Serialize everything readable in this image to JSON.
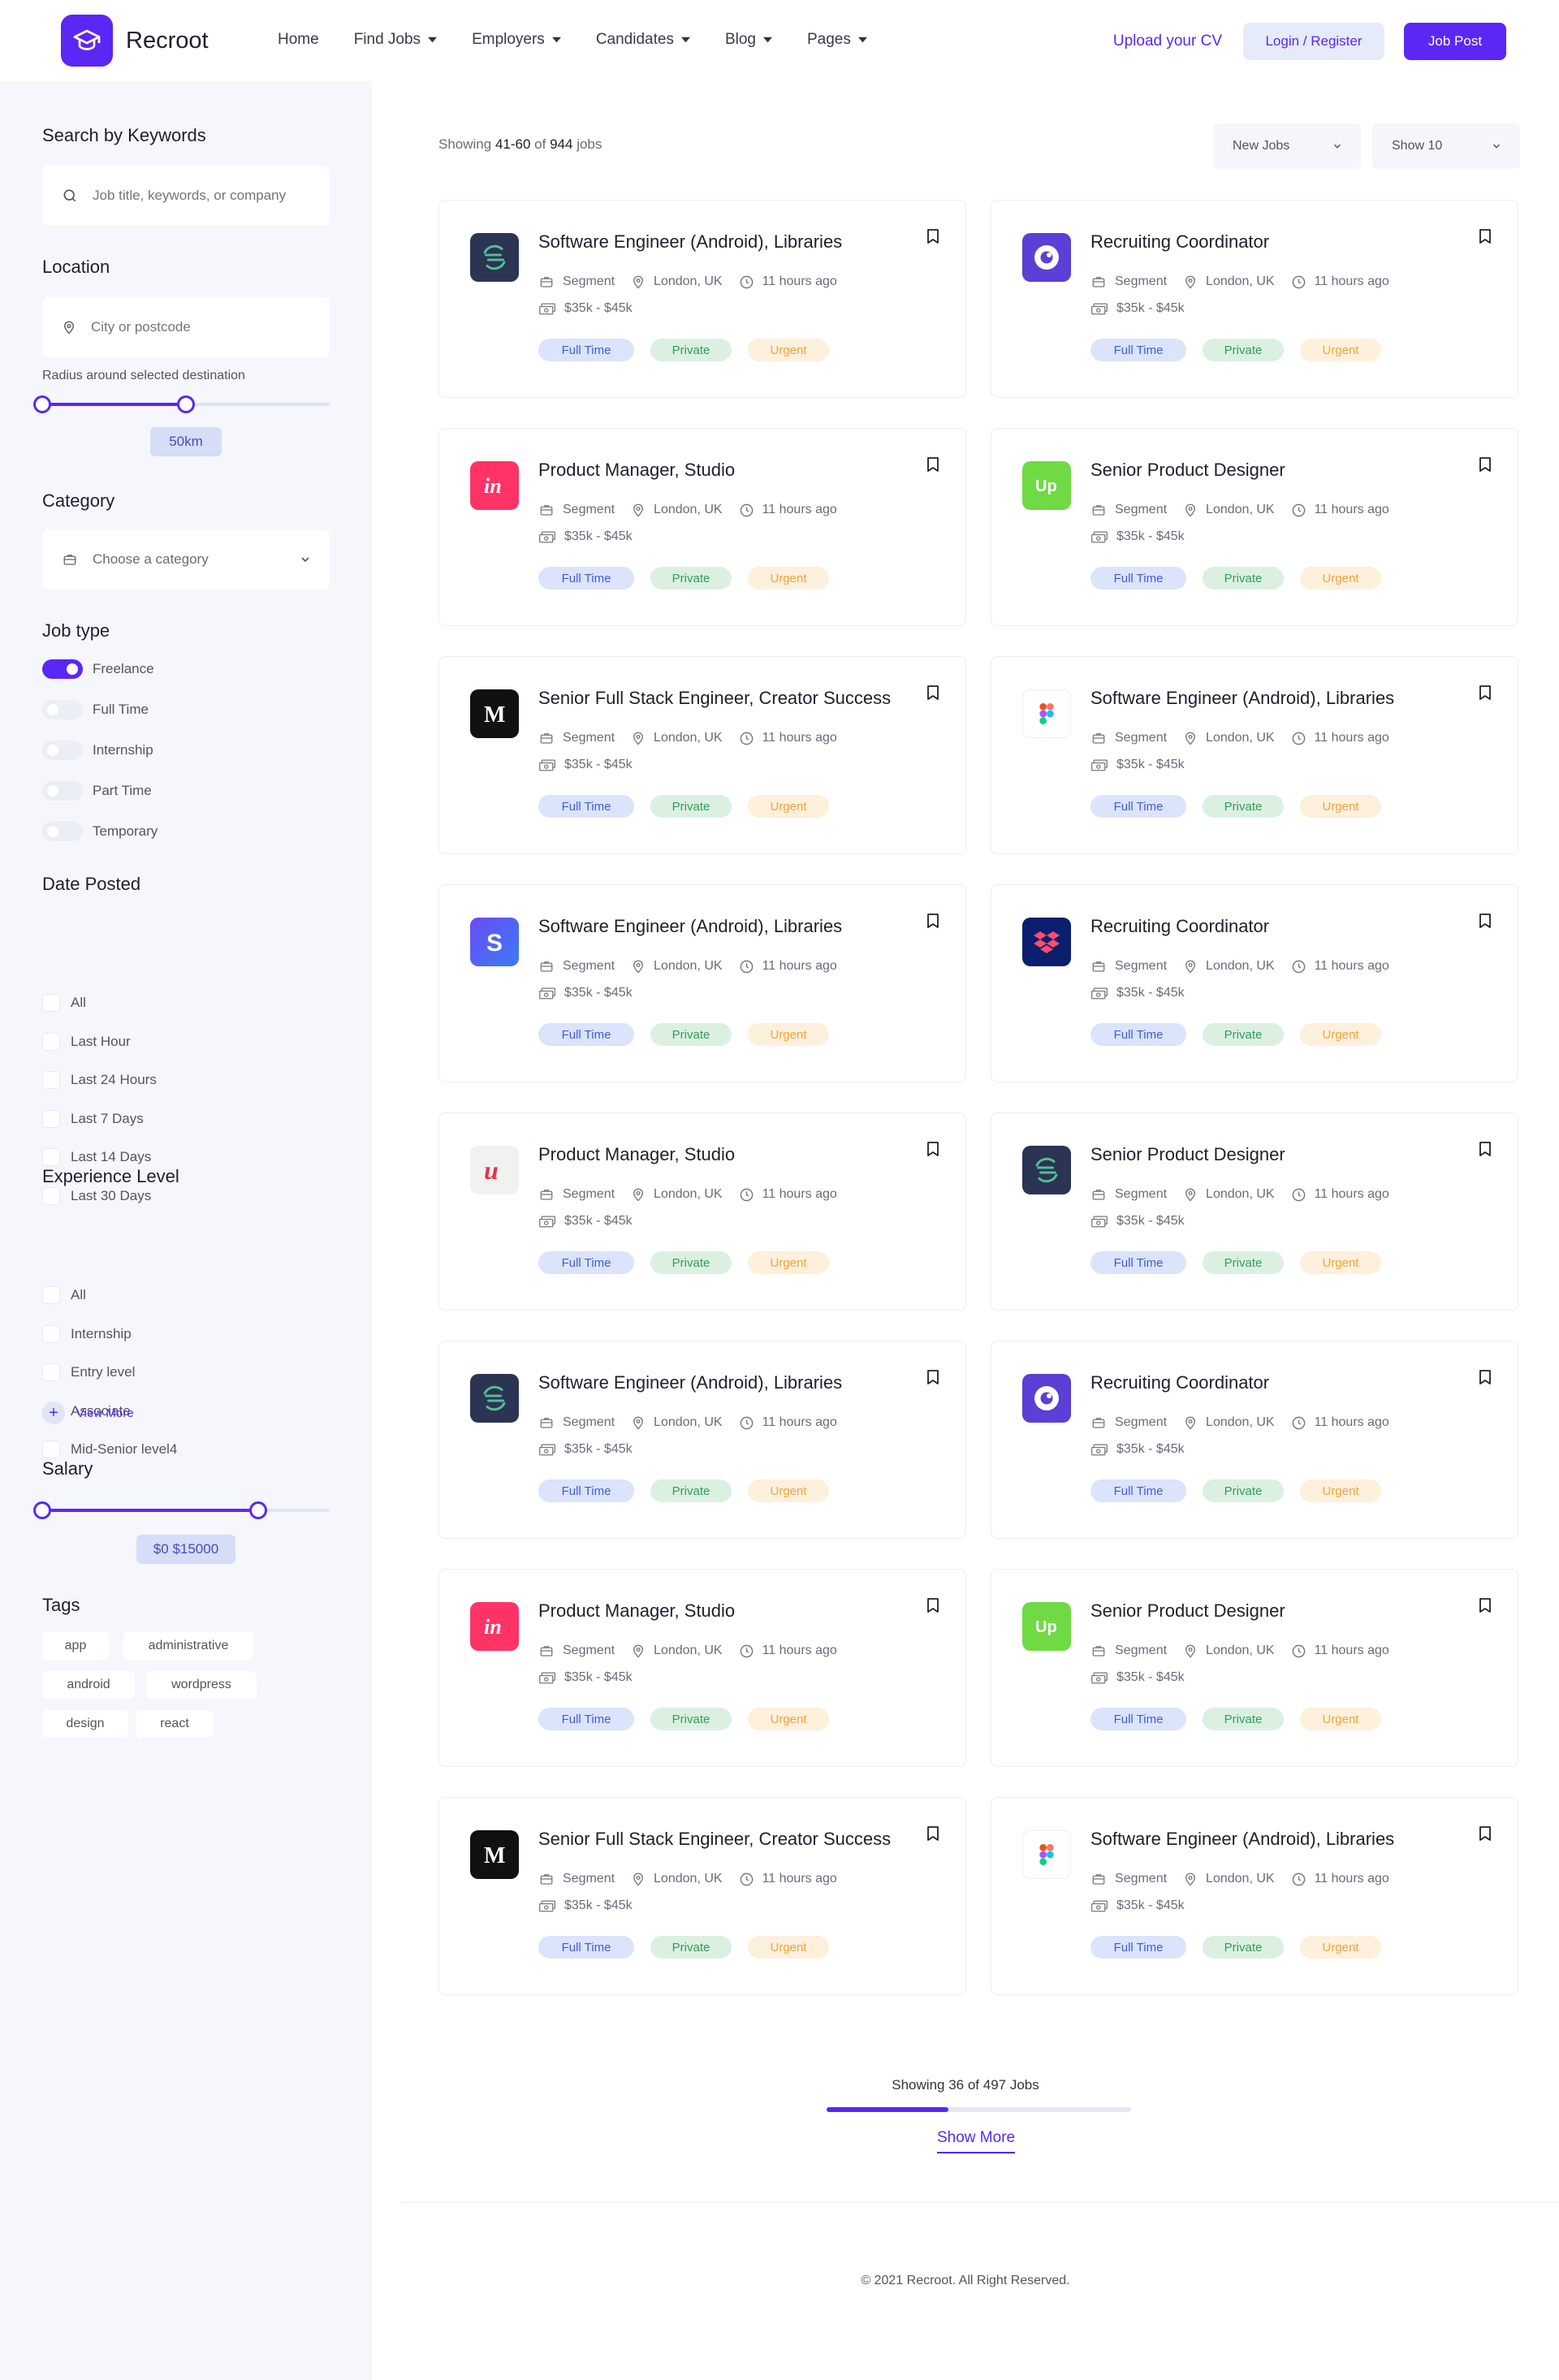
{
  "header": {
    "logo_text": "Recroot",
    "nav": [
      {
        "label": "Home",
        "dropdown": false
      },
      {
        "label": "Find Jobs",
        "dropdown": true
      },
      {
        "label": "Employers",
        "dropdown": true
      },
      {
        "label": "Candidates",
        "dropdown": true
      },
      {
        "label": "Blog",
        "dropdown": true
      },
      {
        "label": "Pages",
        "dropdown": true
      }
    ],
    "upload_cv": "Upload your CV",
    "login_register": "Login / Register",
    "job_post": "Job Post"
  },
  "sidebar": {
    "search_heading": "Search by Keywords",
    "search_placeholder": "Job title, keywords, or company",
    "location_heading": "Location",
    "location_placeholder": "City or postcode",
    "radius_label": "Radius around selected destination",
    "radius_value": "50km",
    "radius_fraction": 0.5,
    "category_heading": "Category",
    "category_value": "Choose a category",
    "job_type_heading": "Job type",
    "job_types": [
      {
        "label": "Freelance",
        "on": true
      },
      {
        "label": "Full Time",
        "on": false
      },
      {
        "label": "Internship",
        "on": false
      },
      {
        "label": "Part Time",
        "on": false
      },
      {
        "label": "Temporary",
        "on": false
      }
    ],
    "date_heading": "Date Posted",
    "date_options": [
      "All",
      "Last Hour",
      "Last 24 Hours",
      "Last 7 Days",
      "Last 14 Days",
      "Last 30 Days"
    ],
    "experience_heading": "Experience Level",
    "experience_options": [
      "All",
      "Internship",
      "Entry level",
      "Associate",
      "Mid-Senior level4"
    ],
    "view_more": "View More",
    "salary_heading": "Salary",
    "salary_value": "$0 $15000",
    "salary_fraction": 0.75,
    "tags_heading": "Tags",
    "tags": [
      "app",
      "administrative",
      "android",
      "wordpress",
      "design",
      "react"
    ]
  },
  "main": {
    "showing_prefix": "Showing",
    "showing_range": "41-60",
    "showing_of": "of",
    "showing_total": "944",
    "showing_suffix": "jobs",
    "sort_select": "New Jobs",
    "show_select": "Show 10",
    "jobs": [
      {
        "title": "Software Engineer (Android), Libraries",
        "company": "Segment",
        "location": "London, UK",
        "time": "11 hours ago",
        "salary": "$35k - $45k",
        "logo": "segment-logo",
        "badges": [
          "Full Time",
          "Private",
          "Urgent"
        ]
      },
      {
        "title": "Recruiting Coordinator",
        "company": "Segment",
        "location": "London, UK",
        "time": "11 hours ago",
        "salary": "$35k - $45k",
        "logo": "circle-purple-logo",
        "badges": [
          "Full Time",
          "Private",
          "Urgent"
        ]
      },
      {
        "title": "Product Manager, Studio",
        "company": "Segment",
        "location": "London, UK",
        "time": "11 hours ago",
        "salary": "$35k - $45k",
        "logo": "invision-logo",
        "badges": [
          "Full Time",
          "Private",
          "Urgent"
        ]
      },
      {
        "title": "Senior Product Designer",
        "company": "Segment",
        "location": "London, UK",
        "time": "11 hours ago",
        "salary": "$35k - $45k",
        "logo": "upwork-logo",
        "badges": [
          "Full Time",
          "Private",
          "Urgent"
        ]
      },
      {
        "title": "Senior Full Stack Engineer, Creator Success",
        "company": "Segment",
        "location": "London, UK",
        "time": "11 hours ago",
        "salary": "$35k - $45k",
        "logo": "medium-logo",
        "badges": [
          "Full Time",
          "Private",
          "Urgent"
        ]
      },
      {
        "title": "Software Engineer (Android), Libraries",
        "company": "Segment",
        "location": "London, UK",
        "time": "11 hours ago",
        "salary": "$35k - $45k",
        "logo": "figma-logo",
        "badges": [
          "Full Time",
          "Private",
          "Urgent"
        ]
      },
      {
        "title": "Software Engineer (Android), Libraries",
        "company": "Segment",
        "location": "London, UK",
        "time": "11 hours ago",
        "salary": "$35k - $45k",
        "logo": "stripe-s-logo",
        "badges": [
          "Full Time",
          "Private",
          "Urgent"
        ]
      },
      {
        "title": "Recruiting Coordinator",
        "company": "Segment",
        "location": "London, UK",
        "time": "11 hours ago",
        "salary": "$35k - $45k",
        "logo": "dropbox-logo",
        "badges": [
          "Full Time",
          "Private",
          "Urgent"
        ]
      },
      {
        "title": "Product Manager, Studio",
        "company": "Segment",
        "location": "London, UK",
        "time": "11 hours ago",
        "salary": "$35k - $45k",
        "logo": "u-script-logo",
        "badges": [
          "Full Time",
          "Private",
          "Urgent"
        ]
      },
      {
        "title": "Senior Product Designer",
        "company": "Segment",
        "location": "London, UK",
        "time": "11 hours ago",
        "salary": "$35k - $45k",
        "logo": "segment-logo",
        "badges": [
          "Full Time",
          "Private",
          "Urgent"
        ]
      },
      {
        "title": "Software Engineer (Android), Libraries",
        "company": "Segment",
        "location": "London, UK",
        "time": "11 hours ago",
        "salary": "$35k - $45k",
        "logo": "segment-logo",
        "badges": [
          "Full Time",
          "Private",
          "Urgent"
        ]
      },
      {
        "title": "Recruiting Coordinator",
        "company": "Segment",
        "location": "London, UK",
        "time": "11 hours ago",
        "salary": "$35k - $45k",
        "logo": "circle-purple-logo",
        "badges": [
          "Full Time",
          "Private",
          "Urgent"
        ]
      },
      {
        "title": "Product Manager, Studio",
        "company": "Segment",
        "location": "London, UK",
        "time": "11 hours ago",
        "salary": "$35k - $45k",
        "logo": "invision-logo",
        "badges": [
          "Full Time",
          "Private",
          "Urgent"
        ]
      },
      {
        "title": "Senior Product Designer",
        "company": "Segment",
        "location": "London, UK",
        "time": "11 hours ago",
        "salary": "$35k - $45k",
        "logo": "upwork-logo",
        "badges": [
          "Full Time",
          "Private",
          "Urgent"
        ]
      },
      {
        "title": "Senior Full Stack Engineer, Creator Success",
        "company": "Segment",
        "location": "London, UK",
        "time": "11 hours ago",
        "salary": "$35k - $45k",
        "logo": "medium-logo",
        "badges": [
          "Full Time",
          "Private",
          "Urgent"
        ]
      },
      {
        "title": "Software Engineer (Android), Libraries",
        "company": "Segment",
        "location": "London, UK",
        "time": "11 hours ago",
        "salary": "$35k - $45k",
        "logo": "figma-logo",
        "badges": [
          "Full Time",
          "Private",
          "Urgent"
        ]
      }
    ],
    "load_status": "Showing 36 of 497 Jobs",
    "load_progress": 0.4,
    "show_more": "Show More",
    "copyright": "© 2021 Recroot. All Right Reserved."
  },
  "colors": {
    "accent": "#5b27f5",
    "sidebar_bg": "#f5f7fc",
    "badge_fulltime": "#dbe4fb",
    "badge_private": "#dcf0e2",
    "badge_urgent": "#fdf0dc"
  }
}
